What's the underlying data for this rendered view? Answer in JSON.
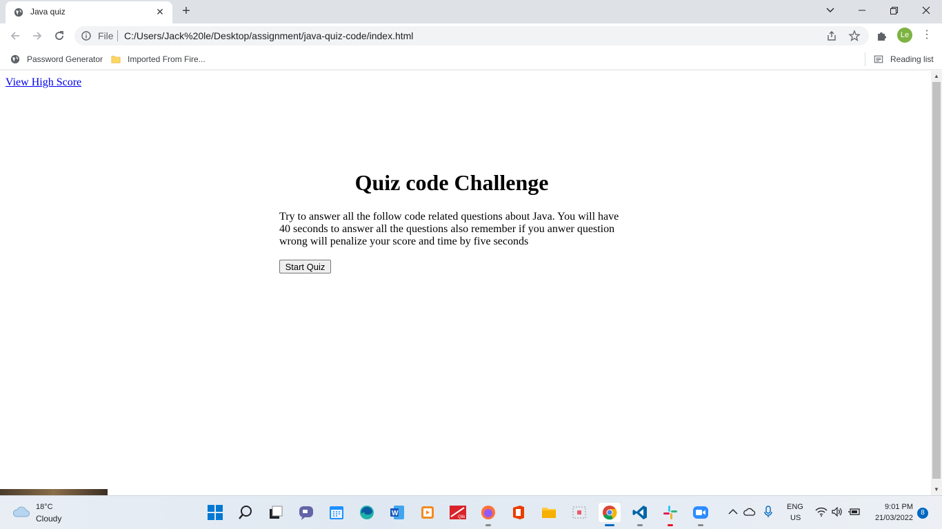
{
  "browser": {
    "tab_title": "Java quiz",
    "address_scheme": "File",
    "address_url": "C:/Users/Jack%20le/Desktop/assignment/java-quiz-code/index.html",
    "profile_initials": "Le",
    "profile_color": "#7cb342",
    "bookmarks": [
      "Password Generator",
      "Imported From Fire..."
    ],
    "reading_list": "Reading list"
  },
  "page": {
    "high_score_link": "View High Score",
    "title": "Quiz code Challenge",
    "description": "Try to answer all the follow code related questions about Java. You will have 40 seconds to answer all the questions also remember if you anwer question wrong will penalize your score and time by five seconds",
    "start_button": "Start Quiz"
  },
  "taskbar": {
    "weather_temp": "18°C",
    "weather_desc": "Cloudy",
    "language_top": "ENG",
    "language_bottom": "US",
    "time": "9:01 PM",
    "date": "21/03/2022",
    "notification_count": "8"
  }
}
